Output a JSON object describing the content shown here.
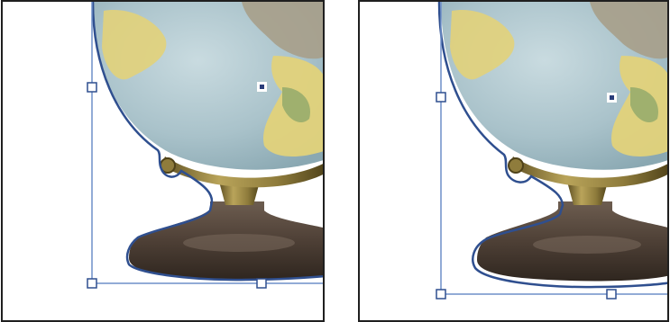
{
  "colors": {
    "frame_border": "#1f1f1f",
    "selection_outline": "#2f4f8f",
    "bounding_box": "#6f8fc8",
    "handle_fill": "#ffffff",
    "reference_point": "#2a3d7a",
    "globe_ocean": "#a9c2ca",
    "globe_land_yellow": "#e2d27a",
    "globe_land_grey": "#a79e8a",
    "stand_brass": "#8f7c3c",
    "base_dark": "#4e4036"
  },
  "panels": [
    {
      "name": "before-wrap",
      "icons": [
        "globe-image",
        "text-wrap-contour",
        "bounding-box",
        "selection-handle-icon",
        "reference-point-icon"
      ]
    },
    {
      "name": "after-wrap",
      "icons": [
        "globe-image",
        "text-wrap-contour",
        "bounding-box",
        "selection-handle-icon",
        "reference-point-icon"
      ]
    }
  ]
}
